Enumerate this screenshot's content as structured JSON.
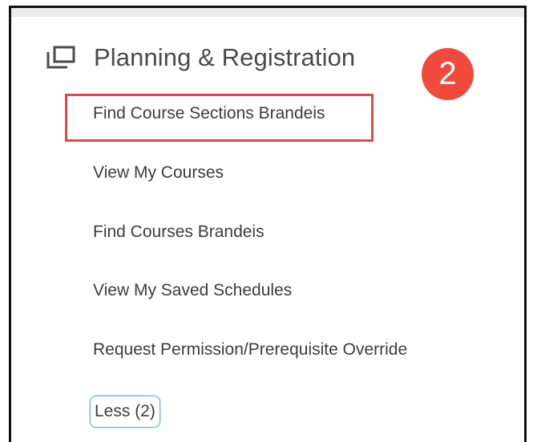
{
  "section": {
    "icon": "windows-icon",
    "title": "Planning & Registration"
  },
  "step_badge": "2",
  "tasks": [
    {
      "label": "Find Course Sections Brandeis",
      "highlighted": true
    },
    {
      "label": "View My Courses"
    },
    {
      "label": "Find Courses Brandeis"
    },
    {
      "label": "View My Saved Schedules"
    },
    {
      "label": "Request Permission/Prerequisite Override"
    }
  ],
  "less_button": "Less (2)",
  "colors": {
    "badge": "#ef4a3b",
    "highlight": "#e4474b",
    "focus": "#66b3e6",
    "text": "#3c3c3c"
  }
}
